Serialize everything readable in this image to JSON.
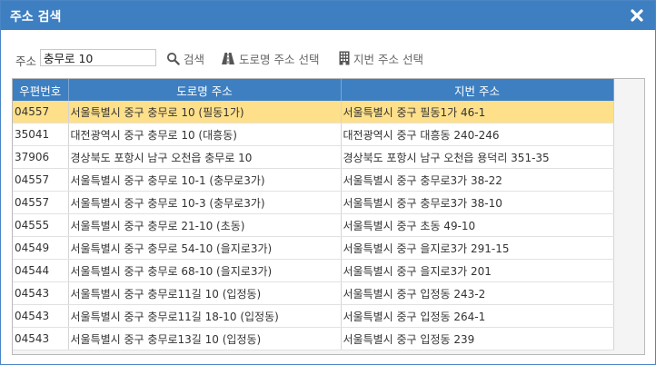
{
  "dialog": {
    "title": "주소 검색"
  },
  "search": {
    "label": "주소",
    "value": "충무로 10"
  },
  "toolbar": {
    "search_label": "검색",
    "road_label": "도로명 주소 선택",
    "lot_label": "지번 주소 선택"
  },
  "colors": {
    "header": "#3e7fc1",
    "selected_row": "#ffe08a"
  },
  "table": {
    "columns": [
      "우편번호",
      "도로명 주소",
      "지번 주소"
    ],
    "rows": [
      [
        "04557",
        "서울특별시 중구 충무로 10 (필동1가)",
        "서울특별시 중구 필동1가 46-1"
      ],
      [
        "35041",
        "대전광역시 중구 충무로 10 (대흥동)",
        "대전광역시 중구 대흥동 240-246"
      ],
      [
        "37906",
        "경상북도 포항시 남구 오천읍 충무로 10",
        "경상북도 포항시 남구 오천읍 용덕리 351-35"
      ],
      [
        "04557",
        "서울특별시 중구 충무로 10-1 (충무로3가)",
        "서울특별시 중구 충무로3가 38-22"
      ],
      [
        "04557",
        "서울특별시 중구 충무로 10-3 (충무로3가)",
        "서울특별시 중구 충무로3가 38-10"
      ],
      [
        "04555",
        "서울특별시 중구 충무로 21-10 (초동)",
        "서울특별시 중구 초동 49-10"
      ],
      [
        "04549",
        "서울특별시 중구 충무로 54-10 (을지로3가)",
        "서울특별시 중구 을지로3가 291-15"
      ],
      [
        "04544",
        "서울특별시 중구 충무로 68-10 (을지로3가)",
        "서울특별시 중구 을지로3가 201"
      ],
      [
        "04543",
        "서울특별시 중구 충무로11길 10 (입정동)",
        "서울특별시 중구 입정동 243-2"
      ],
      [
        "04543",
        "서울특별시 중구 충무로11길 18-10 (입정동)",
        "서울특별시 중구 입정동 264-1"
      ],
      [
        "04543",
        "서울특별시 중구 충무로13길 10 (입정동)",
        "서울특별시 중구 입정동 239"
      ]
    ]
  }
}
